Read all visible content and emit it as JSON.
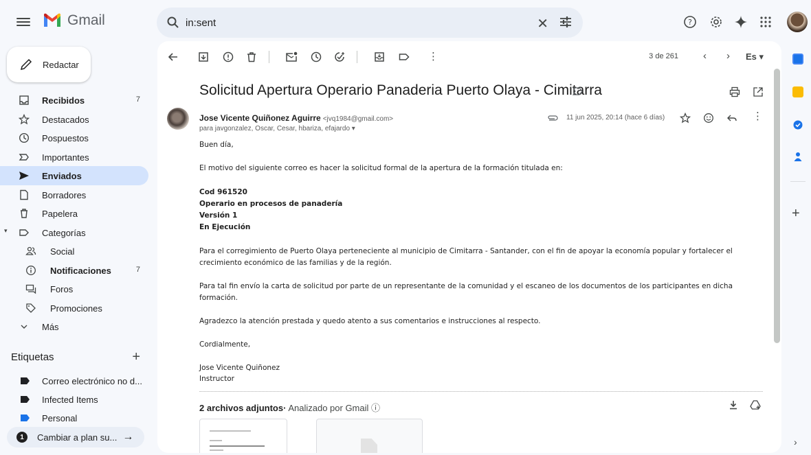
{
  "app": {
    "name": "Gmail"
  },
  "search": {
    "query": "in:sent"
  },
  "compose": {
    "label": "Redactar"
  },
  "nav": [
    {
      "label": "Recibidos",
      "count": "7",
      "bold": true,
      "icon": "inbox-icon"
    },
    {
      "label": "Destacados",
      "count": "",
      "icon": "star-icon"
    },
    {
      "label": "Pospuestos",
      "count": "",
      "icon": "clock-icon"
    },
    {
      "label": "Importantes",
      "count": "",
      "icon": "important-icon"
    },
    {
      "label": "Enviados",
      "count": "",
      "bold": true,
      "active": true,
      "icon": "send-icon"
    },
    {
      "label": "Borradores",
      "count": "",
      "icon": "draft-icon"
    },
    {
      "label": "Papelera",
      "count": "",
      "icon": "trash-icon"
    },
    {
      "label": "Categorías",
      "count": "",
      "icon": "label-icon"
    },
    {
      "label": "Social",
      "count": "",
      "sub": true,
      "icon": "people-icon"
    },
    {
      "label": "Notificaciones",
      "count": "7",
      "bold": true,
      "sub": true,
      "icon": "info-icon"
    },
    {
      "label": "Foros",
      "count": "",
      "sub": true,
      "icon": "forum-icon"
    },
    {
      "label": "Promociones",
      "count": "",
      "sub": true,
      "icon": "tag-icon"
    },
    {
      "label": "Más",
      "count": "",
      "icon": "chevron-down-icon"
    }
  ],
  "labels": {
    "heading": "Etiquetas",
    "items": [
      {
        "label": "Correo electrónico no d...",
        "color": "#202124"
      },
      {
        "label": "Infected Items",
        "color": "#202124"
      },
      {
        "label": "Personal",
        "color": "#1a73e8"
      }
    ]
  },
  "upgrade": {
    "num": "1",
    "label": "Cambiar a plan su..."
  },
  "toolbar": {
    "pager": "3 de 261",
    "lang": "Es"
  },
  "email": {
    "subject": "Solicitud Apertura Operario Panaderia Puerto Olaya - Cimitarra",
    "sender_name": "Jose Vicente Quiñonez Aguirre",
    "sender_email": "<jvq1984@gmail.com>",
    "recipients": "para javgonzalez, Oscar, Cesar, hbariza, efajardo",
    "date": "11 jun 2025, 20:14 (hace 6 días)",
    "body": {
      "greeting": "Buen día,",
      "p1": "El motivo del siguiente correo es hacer la solicitud formal de la apertura de la formación titulada en:",
      "cod": "Cod 961520",
      "program": "Operario en procesos de panadería",
      "version": "Versión 1",
      "status": "En Ejecución",
      "p2a": "Para el corregimiento de Puerto Olaya perteneciente al municipio de Cimitarra - Santander, con el fin de apoyar la economía popular y fortalecer el",
      "p2b": "crecimiento económico de las familias y de la región.",
      "p3a": "Para tal fin envío la carta de solicitud por parte de un representante de la comunidad y el escaneo de los documentos de los participantes en dicha",
      "p3b": "formación.",
      "p4": "Agradezco la atención prestada y quedo atento a sus comentarios e instrucciones al respecto.",
      "closing": "Cordialmente,",
      "sig_name": "Jose Vicente Quiñonez",
      "sig_role": "Instructor"
    },
    "attachments": {
      "count_label": "2 archivos adjuntos",
      "scanned": " Analizado por Gmail"
    }
  },
  "colors": {
    "bg": "#f6f8fc",
    "active": "#d3e3fd",
    "search": "#e9eef6"
  }
}
